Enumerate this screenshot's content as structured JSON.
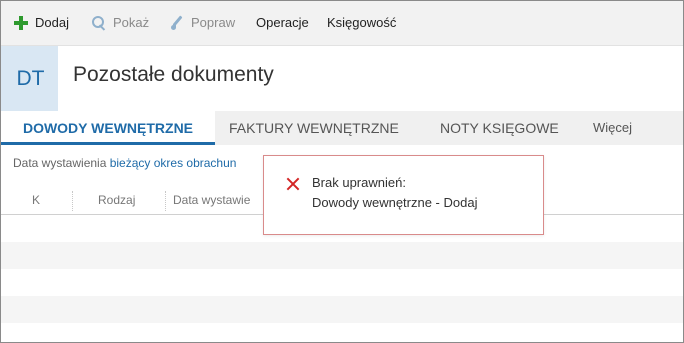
{
  "toolbar": {
    "items": [
      {
        "label": "Dodaj",
        "icon": "plus-icon",
        "enabled": true
      },
      {
        "label": "Pokaż",
        "icon": "search-icon",
        "enabled": false
      },
      {
        "label": "Popraw",
        "icon": "edit-icon",
        "enabled": false
      },
      {
        "label": "Operacje",
        "enabled": true
      },
      {
        "label": "Księgowość",
        "enabled": true
      }
    ]
  },
  "header": {
    "badge": "DT",
    "title": "Pozostałe dokumenty"
  },
  "tabs": {
    "items": [
      "DOWODY WEWNĘTRZNE",
      "FAKTURY WEWNĘTRZNE",
      "NOTY KSIĘGOWE"
    ],
    "active_index": 0,
    "more": "Więcej"
  },
  "filter": {
    "label": "Data wystawienia",
    "value": "bieżący okres obrachun"
  },
  "table": {
    "columns": [
      "K",
      "Rodzaj",
      "Data wystawie"
    ]
  },
  "popup": {
    "line1": "Brak uprawnień:",
    "line2": "Dowody wewnętrzne - Dodaj"
  },
  "colors": {
    "accent": "#1f6ba8",
    "add_icon": "#2e9a2e",
    "error": "#d32626",
    "popup_border": "#d98b8b"
  }
}
